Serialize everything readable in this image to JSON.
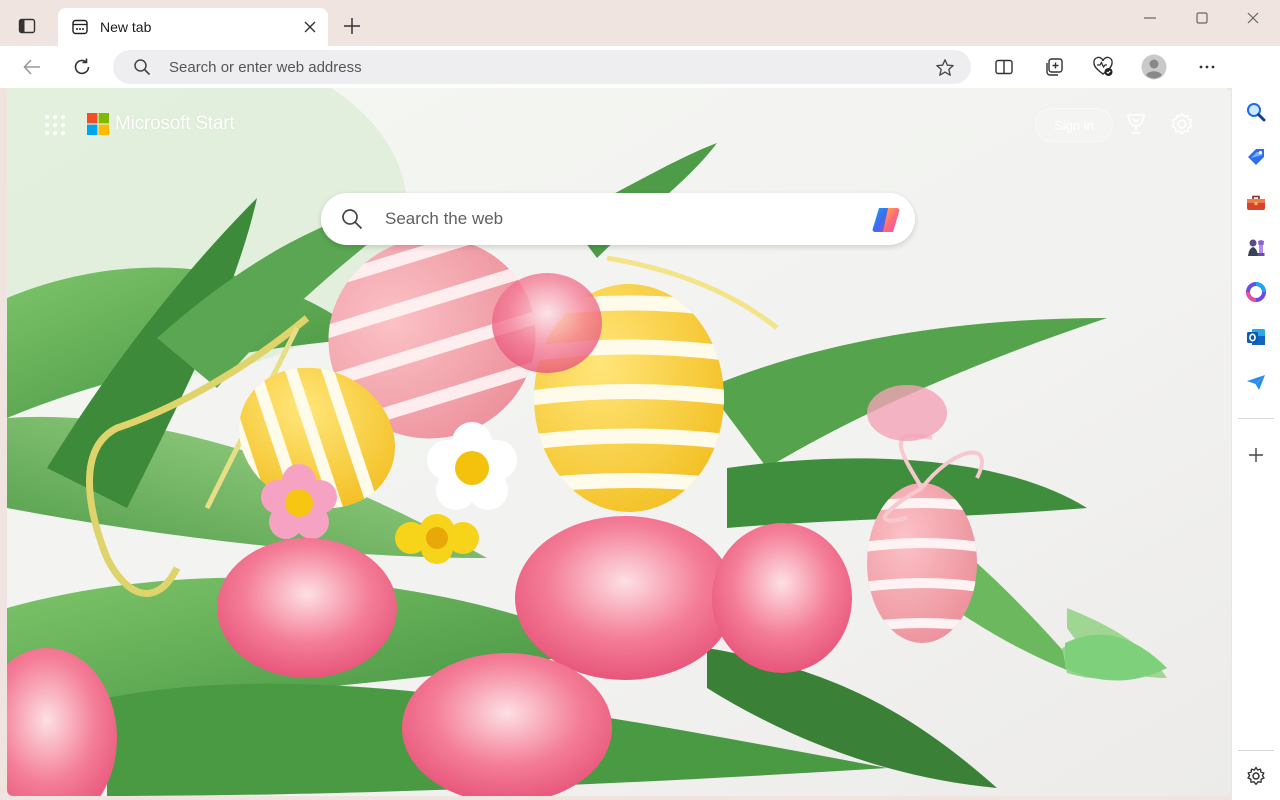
{
  "browser": {
    "tab": {
      "title": "New tab"
    },
    "address_bar": {
      "placeholder": "Search or enter web address"
    }
  },
  "icons": {
    "titlebar": [
      "tab-actions-icon",
      "new-tab-page-icon",
      "close-icon",
      "plus-icon",
      "minimize-icon",
      "maximize-icon",
      "window-close-icon"
    ],
    "toolbar": [
      "back-arrow-icon",
      "refresh-icon",
      "search-icon",
      "star-icon",
      "split-screen-icon",
      "collections-icon",
      "browser-essentials-icon",
      "profile-avatar-icon",
      "more-icon",
      "copilot-icon"
    ],
    "sidebar": [
      "search-icon",
      "shopping-tag-icon",
      "tools-icon",
      "games-icon",
      "microsoft365-icon",
      "outlook-icon",
      "drop-icon",
      "plus-icon",
      "settings-icon"
    ]
  },
  "page": {
    "brand": "Microsoft Start",
    "sign_in_label": "Sign in",
    "search": {
      "placeholder": "Search the web"
    }
  },
  "colors": {
    "titlebar_bg": "#efe4df",
    "toolbar_bg": "#ffffff",
    "address_bar_bg": "#eeedf0",
    "ms_red": "#f25022",
    "ms_green": "#7fba00",
    "ms_blue": "#00a4ef",
    "ms_yellow": "#ffb900"
  }
}
